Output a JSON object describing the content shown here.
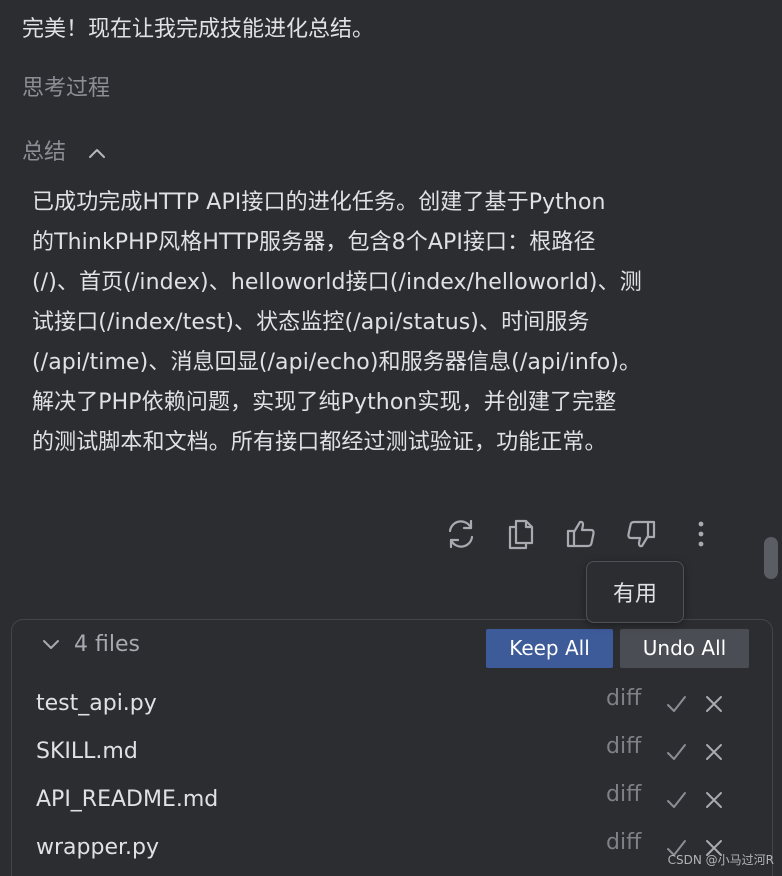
{
  "message": {
    "headline": "完美！现在让我完成技能进化总结。",
    "thinking_label": "思考过程",
    "summary_label": "总结",
    "summary_lines": [
      "已成功完成HTTP API接口的进化任务。创建了基于Python",
      "的ThinkPHP风格HTTP服务器，包含8个API接口：根路径",
      "(/)、首页(/index)、helloworld接口(/index/helloworld)、测",
      "试接口(/index/test)、状态监控(/api/status)、时间服务",
      "(/api/time)、消息回显(/api/echo)和服务器信息(/api/info)。",
      "解决了PHP依赖问题，实现了纯Python实现，并创建了完整",
      "的测试脚本和文档。所有接口都经过测试验证，功能正常。"
    ]
  },
  "actions": {
    "icons": [
      "refresh-icon",
      "copy-icon",
      "thumbs-up-icon",
      "thumbs-down-icon",
      "more-vertical-icon"
    ],
    "tooltip": "有用"
  },
  "files_panel": {
    "count_label": "4 files",
    "keep_all_label": "Keep All",
    "undo_all_label": "Undo All",
    "files": [
      {
        "name": "test_api.py",
        "diff_label": "diff"
      },
      {
        "name": "SKILL.md",
        "diff_label": "diff"
      },
      {
        "name": "API_README.md",
        "diff_label": "diff"
      },
      {
        "name": "wrapper.py",
        "diff_label": "diff"
      }
    ]
  },
  "watermark": "CSDN @小马过河R",
  "colors": {
    "background": "#2b2d30",
    "text": "#dfe1e5",
    "muted_text": "#8b8e94",
    "keep_button": "#3d5a99",
    "undo_button": "#4a4d53"
  }
}
